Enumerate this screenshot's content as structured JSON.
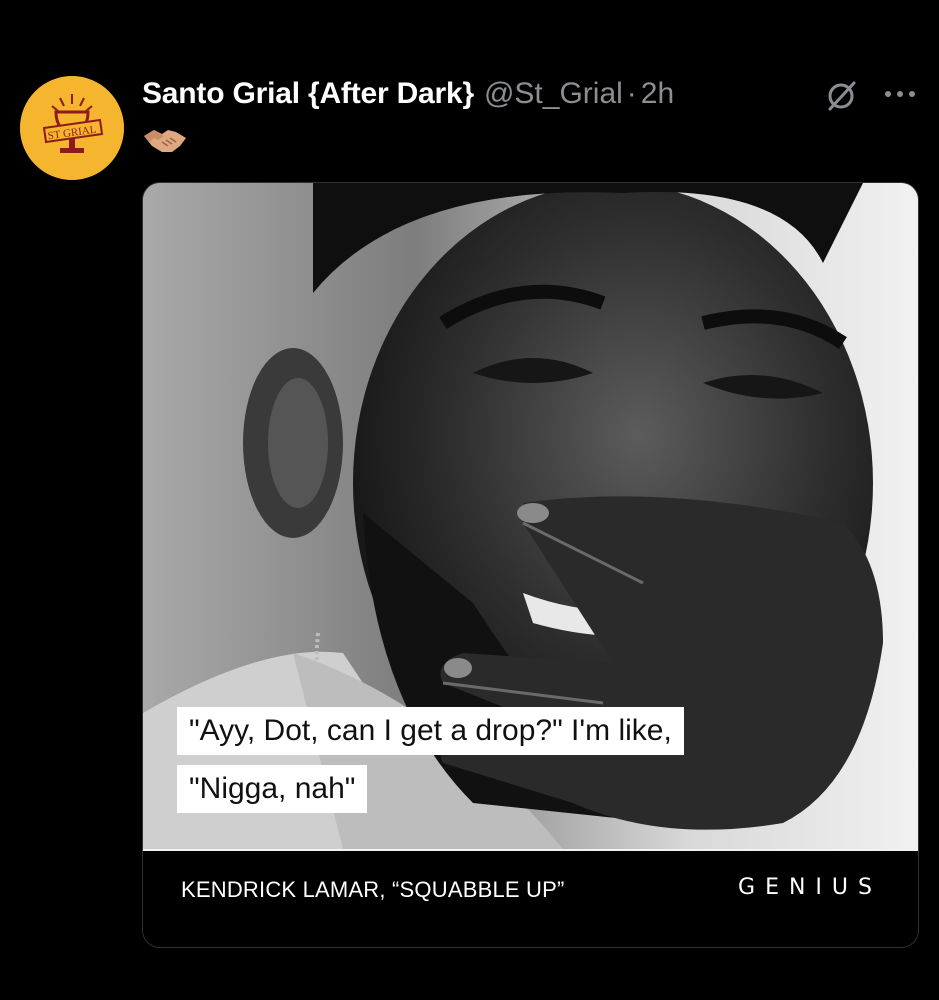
{
  "tweet": {
    "author": {
      "display_name": "Santo Grial {After Dark}",
      "handle": "@St_Grial",
      "avatar_icon": "holy-grail-logo-icon",
      "avatar_color": "#f5b52e",
      "avatar_text": "ST GRIAL"
    },
    "separator": "·",
    "timestamp": "2h",
    "header_icons": [
      "grok-icon",
      "more-options-icon"
    ],
    "text_emoji": "handshake-icon",
    "media": {
      "lyric_line_1": "\"Ayy, Dot, can I get a drop?\" I'm like,",
      "lyric_line_2": "\"Nigga, nah\"",
      "credit": "KENDRICK LAMAR, “SQUABBLE UP”",
      "brand": "GENIUS"
    }
  }
}
